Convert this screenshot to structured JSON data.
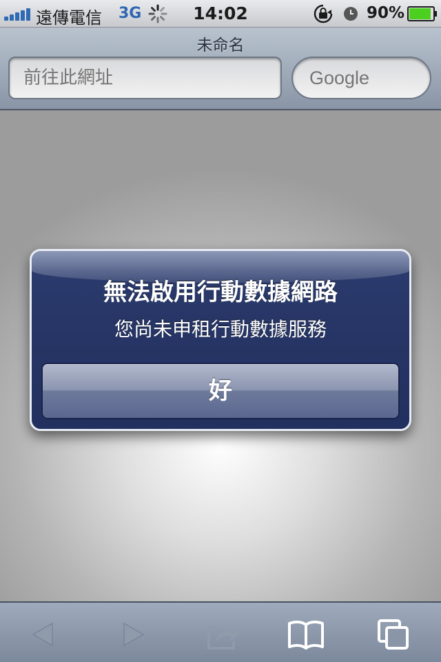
{
  "status_bar": {
    "carrier": "遠傳電信",
    "network": "3G",
    "time": "14:02",
    "battery_percent": "90%",
    "icons": [
      "signal-icon",
      "activity-spinner-icon",
      "rotation-lock-icon",
      "alarm-clock-icon",
      "battery-icon"
    ]
  },
  "safari": {
    "page_title": "未命名",
    "url_placeholder": "前往此網址",
    "search_placeholder": "Google"
  },
  "alert": {
    "title": "無法啟用行動數據網路",
    "message": "您尚未申租行動數據服務",
    "button_label": "好"
  },
  "toolbar": {
    "icons": [
      "back-arrow-icon",
      "forward-arrow-icon",
      "share-icon",
      "bookmarks-icon",
      "pages-icon"
    ]
  },
  "colors": {
    "alert_background": "#273666",
    "network_label": "#2f67b2",
    "battery_fill": "#4cd020"
  }
}
